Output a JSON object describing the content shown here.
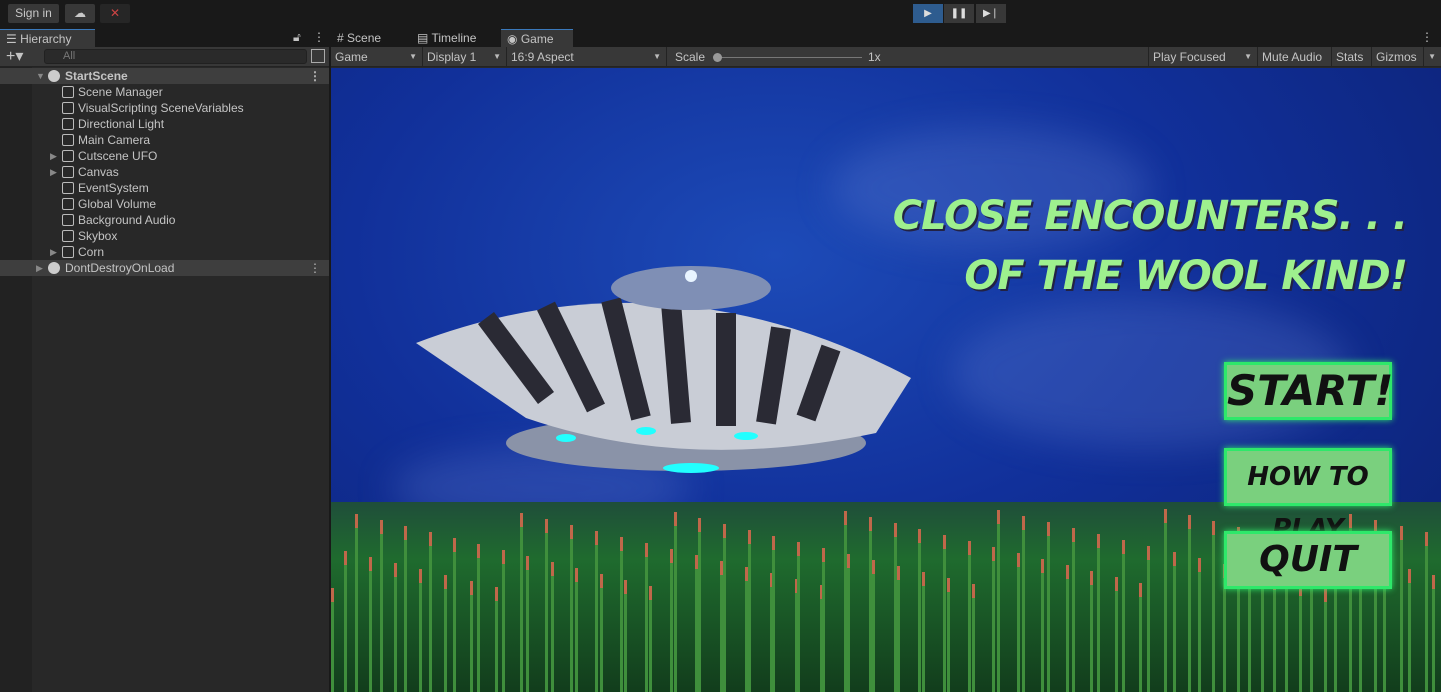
{
  "topbar": {
    "sign_in": "Sign in",
    "cloud_icon": "cloud-icon",
    "collab_icon": "collab-icon"
  },
  "playback": {
    "play": "▶",
    "pause": "❚❚",
    "step": "▶❘"
  },
  "hierarchy": {
    "tab_label": "Hierarchy",
    "search_placeholder": "All",
    "scene": "StartScene",
    "items": [
      "Scene Manager",
      "VisualScripting SceneVariables",
      "Directional Light",
      "Main Camera",
      "Cutscene UFO",
      "Canvas",
      "EventSystem",
      "Global Volume",
      "Background Audio",
      "Skybox",
      "Corn"
    ],
    "dont_destroy": "DontDestroyOnLoad"
  },
  "game_panel": {
    "tabs": [
      "Scene",
      "Timeline",
      "Game"
    ],
    "toolbar": {
      "mode": "Game",
      "display": "Display 1",
      "aspect": "16:9 Aspect",
      "scale_label": "Scale",
      "scale_value": "1x",
      "scale_fraction": 0,
      "play_focused": "Play Focused",
      "mute_audio": "Mute Audio",
      "stats": "Stats",
      "gizmos": "Gizmos"
    }
  },
  "game": {
    "title_line1": "CLOSE ENCOUNTERS. . .",
    "title_line2": "OF THE WOOL KIND!",
    "buttons": [
      "START!",
      "HOW TO PLAY",
      "QUIT"
    ],
    "colors": {
      "title": "#9ef08e",
      "button_fill": "#7ad07e",
      "button_border": "#2ee86a",
      "sky": "#11309a"
    }
  }
}
